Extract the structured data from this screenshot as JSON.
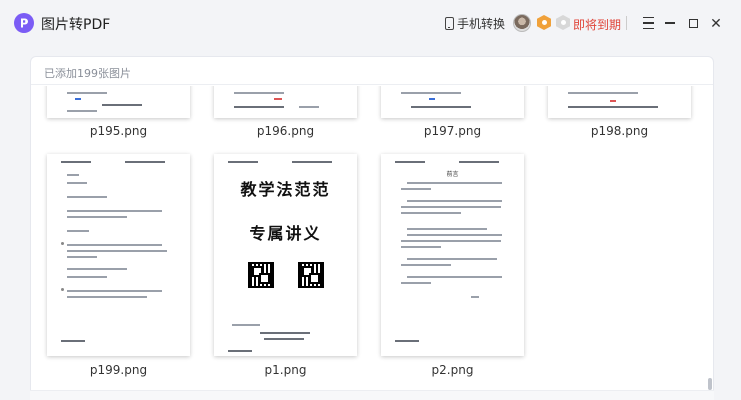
{
  "app": {
    "title": "图片转PDF",
    "phone_convert_label": "手机转换",
    "expire_label": "即将到期"
  },
  "panel": {
    "count_text": "已添加199张图片"
  },
  "thumbnails": [
    {
      "name": "p195.png"
    },
    {
      "name": "p196.png"
    },
    {
      "name": "p197.png"
    },
    {
      "name": "p198.png"
    },
    {
      "name": "p199.png"
    },
    {
      "name": "p1.png",
      "heading1": "教学法范范",
      "heading2": "专属讲义"
    },
    {
      "name": "p2.png",
      "heading": "前言"
    }
  ],
  "colors": {
    "brand": "#7b5cf5",
    "expire": "#e0453a",
    "vip": "#f0a13a"
  }
}
